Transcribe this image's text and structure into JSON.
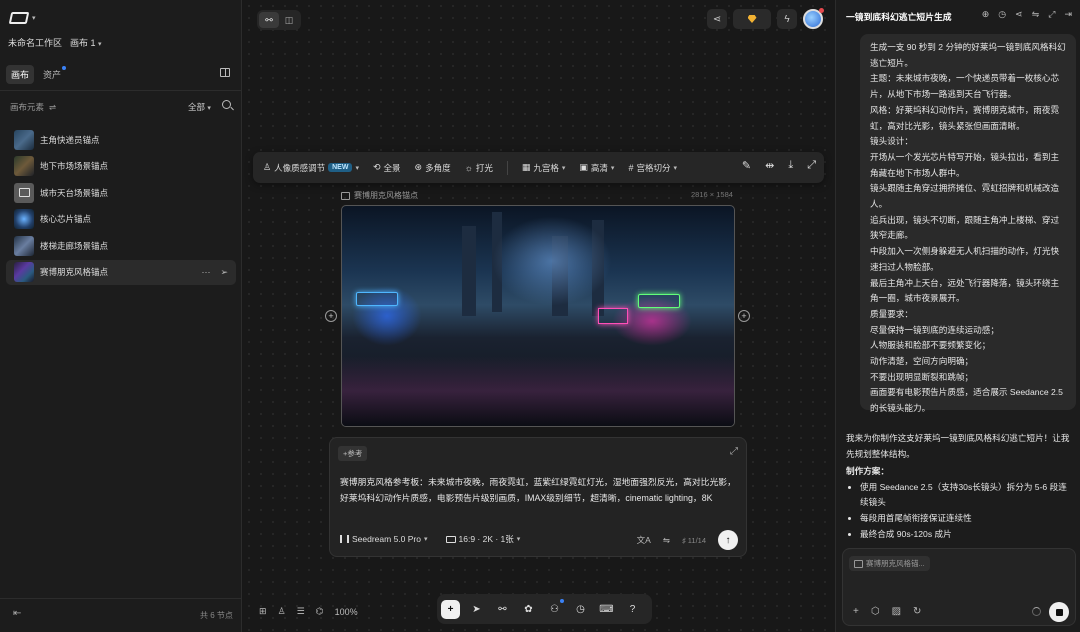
{
  "workspace": {
    "name": "未命名工作区",
    "canvas": "画布 1"
  },
  "left_tabs": [
    {
      "label": "画布"
    },
    {
      "label": "资产"
    }
  ],
  "elements_header": "画布元素",
  "filter_label": "全部",
  "elements": [
    {
      "label": "主角快递员锚点"
    },
    {
      "label": "地下市场场景锚点"
    },
    {
      "label": "城市天台场景锚点"
    },
    {
      "label": "核心芯片锚点"
    },
    {
      "label": "楼梯走廊场景锚点"
    },
    {
      "label": "赛博朋克风格锚点"
    }
  ],
  "node_count": "共 6 节点",
  "zoom": "100%",
  "toolbar": {
    "portrait": "人像质感调节",
    "new_badge": "NEW",
    "panorama": "全景",
    "multi_angle": "多角度",
    "lighting": "打光",
    "grid9": "九宫格",
    "hd": "高清",
    "grid_cut": "宫格切分"
  },
  "image_node": {
    "label": "赛博朋克风格锚点",
    "dims": "2816 × 1584"
  },
  "prompt": {
    "ref_chip": "+参考",
    "text": "赛博朋克风格参考板：未来城市夜晚，雨夜霓虹，蓝紫红绿霓虹灯光，湿地面强烈反光，高对比光影，好莱坞科幻动作片质感，电影预告片级别画质，IMAX级别细节，超清晰，cinematic lighting，8K",
    "model": "Seedream 5.0 Pro",
    "ratio": "16:9 · 2K · 1张",
    "counter": "11/14"
  },
  "chat": {
    "title": "一镜到底科幻逃亡短片生成",
    "user_message": [
      "生成一支 90 秒到 2 分钟的好莱坞一镜到底风格科幻逃亡短片。",
      "主题：未来城市夜晚，一个快递员带着一枚核心芯片，从地下市场一路逃到天台飞行器。",
      "风格：好莱坞科幻动作片，赛博朋克城市，雨夜霓虹，高对比光影，镜头紧张但画面清晰。",
      "镜头设计：",
      "开场从一个发光芯片特写开始，镜头拉出，看到主角藏在地下市场人群中。",
      "镜头跟随主角穿过拥挤摊位、霓虹招牌和机械改造人。",
      "追兵出现，镜头不切断，跟随主角冲上楼梯、穿过狭窄走廊。",
      "中段加入一次侧身躲避无人机扫描的动作，灯光快速扫过人物脸部。",
      "最后主角冲上天台，远处飞行器降落，镜头环绕主角一圈，城市夜景展开。",
      "质量要求：",
      "尽量保持一镜到底的连续运动感；",
      "人物服装和脸部不要频繁变化；",
      "动作清楚，空间方向明确；",
      "不要出现明显断裂和跳帧；",
      "画面要有电影预告片质感，适合展示 Seedance 2.5 的长镜头能力。"
    ],
    "reply_intro": "我来为你制作这支好莱坞一镜到底风格科幻逃亡短片！让我先规划整体结构。",
    "reply_heading": "制作方案：",
    "reply_points": [
      "使用 Seedance 2.5（支持30s长镜头）拆分为 5-6 段连续镜头",
      "每段用首尾帧衔接保证连续性",
      "最终合成 90s-120s 成片"
    ],
    "input_ref": "赛博朋克风格锚..."
  },
  "colors": {
    "accent_blue": "#3b82f6",
    "new_badge": "#1f5f86",
    "gem": "#f2b233"
  }
}
